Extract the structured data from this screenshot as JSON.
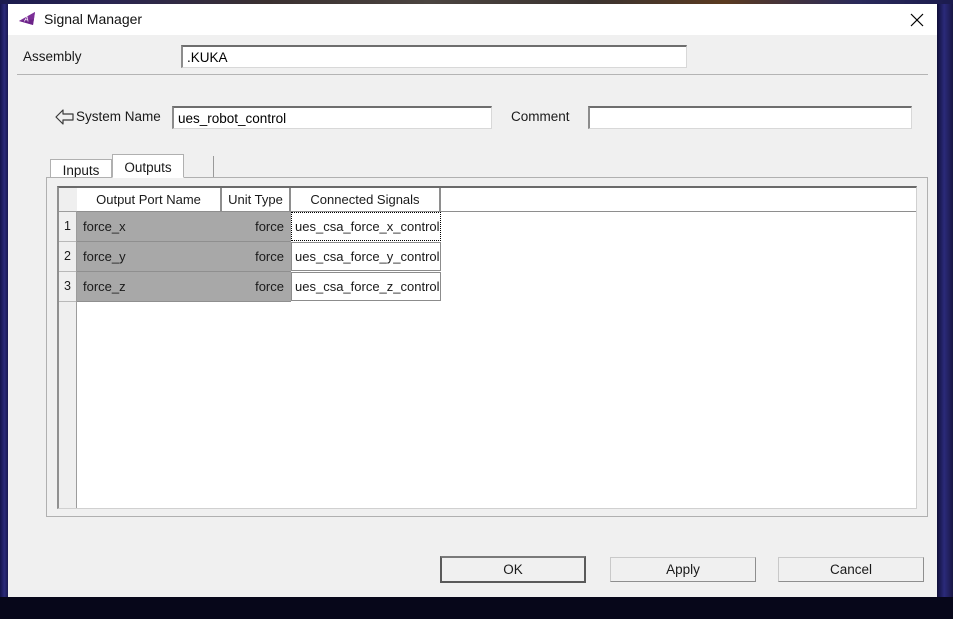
{
  "window": {
    "title": "Signal Manager",
    "icon": "adams-app-icon",
    "close_label": "×"
  },
  "assembly": {
    "label": "Assembly",
    "value": ".KUKA",
    "placeholder": ""
  },
  "system": {
    "back_icon": "left-arrow-icon",
    "name_label": "System Name",
    "name_value": "ues_robot_control",
    "comment_label": "Comment",
    "comment_value": "",
    "comment_placeholder": ""
  },
  "tabs": [
    {
      "label": "Inputs",
      "active": false
    },
    {
      "label": "Outputs",
      "active": true
    }
  ],
  "table": {
    "columns": [
      "Output Port Name",
      "Unit Type",
      "Connected Signals"
    ],
    "rows": [
      {
        "index": "1",
        "port": "force_x",
        "unit": "force",
        "signal": "ues_csa_force_x_control",
        "focused": true
      },
      {
        "index": "2",
        "port": "force_y",
        "unit": "force",
        "signal": "ues_csa_force_y_control",
        "focused": false
      },
      {
        "index": "3",
        "port": "force_z",
        "unit": "force",
        "signal": "ues_csa_force_z_control",
        "focused": false
      }
    ]
  },
  "footer": {
    "ok": "OK",
    "apply": "Apply",
    "cancel": "Cancel"
  },
  "colors": {
    "window_bg": "#f0f0f0",
    "titlebar_bg": "#ffffff",
    "desktop_border": "#2b2a7a",
    "selected_cell": "#a8a8a8",
    "field_bg": "#ffffff",
    "accent": "#8b3a9e"
  }
}
